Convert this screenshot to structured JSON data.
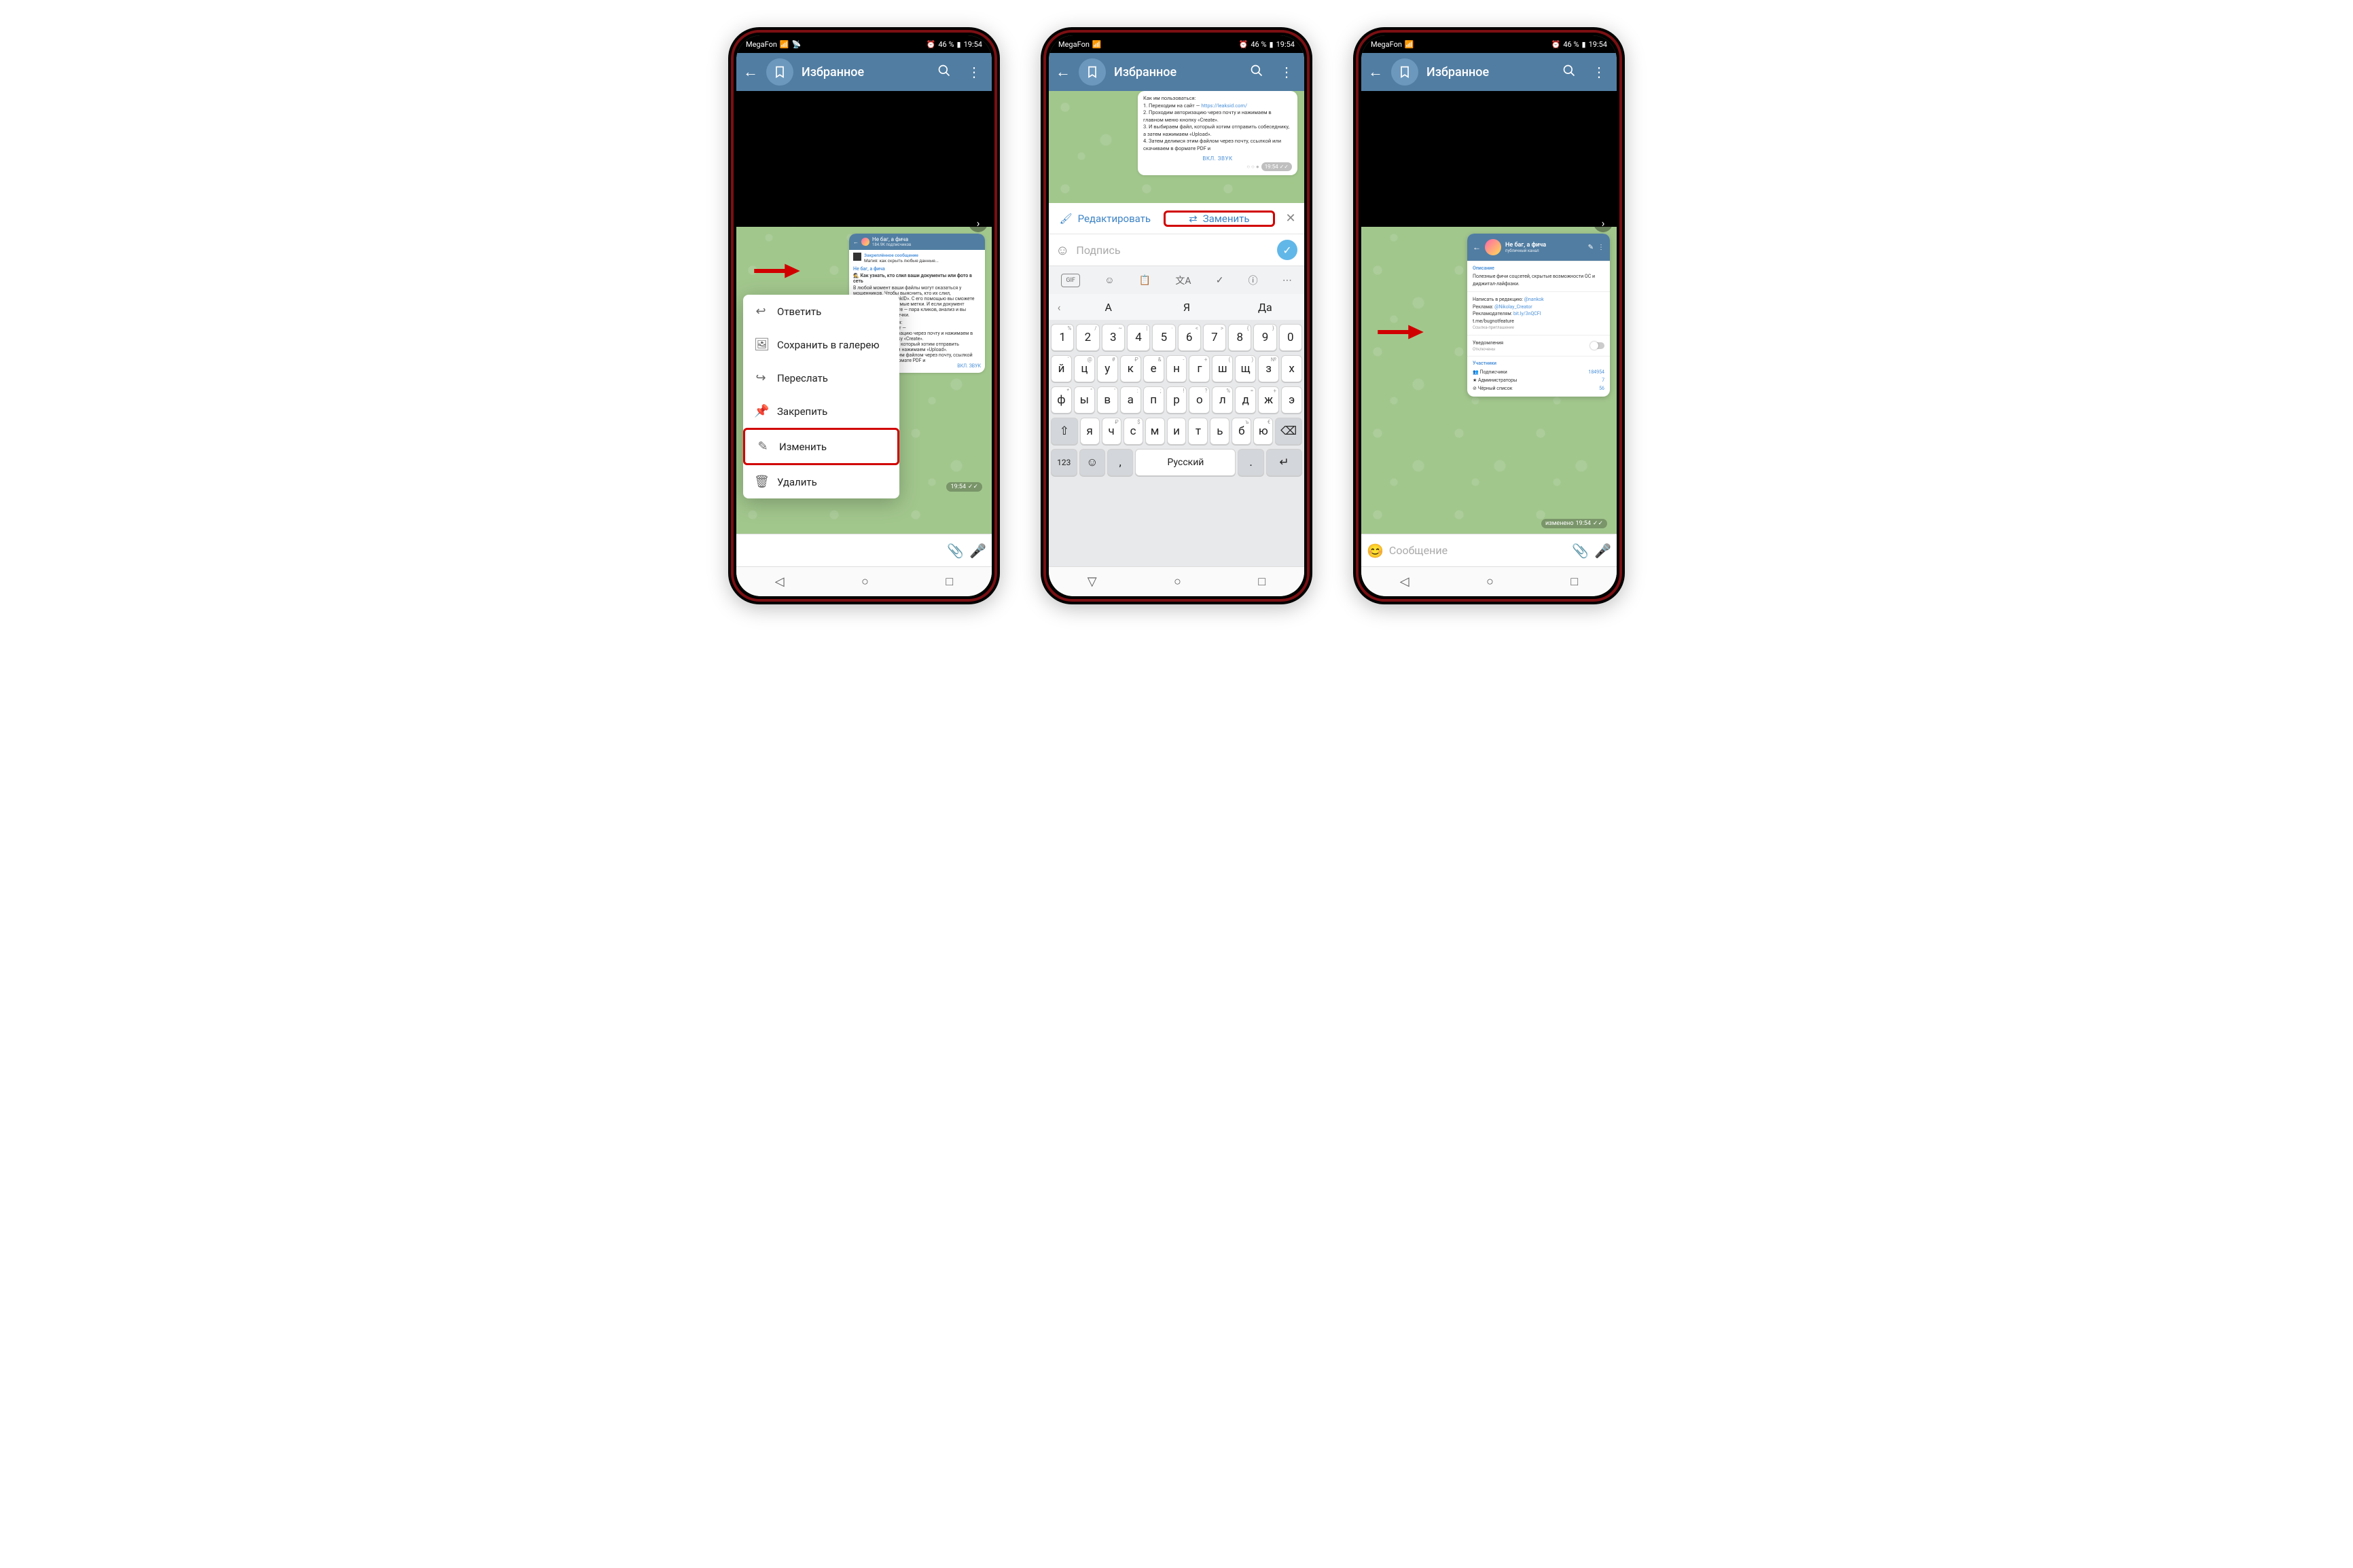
{
  "status": {
    "carrier": "MegaFon",
    "net": "4G",
    "battery": "46 %",
    "time": "19:54",
    "alarm_icon": "⏰"
  },
  "header": {
    "title": "Избранное"
  },
  "ctx": {
    "reply": "Ответить",
    "save": "Сохранить в галерею",
    "forward": "Переслать",
    "pin": "Закрепить",
    "edit": "Изменить",
    "delete": "Удалить"
  },
  "message1": {
    "channel": "Не баг, а фича",
    "subs": "184.9K подписчиков",
    "pinned_label": "Закреплённое сообщение",
    "pinned_text": "Магия: как скрыть любые данные...",
    "reply_ch": "Не баг, а фича",
    "title": "🕵 Как узнать, кто слил ваши документы или фото в сеть",
    "body": "В любой момент ваши файлы могут оказаться у мошенников. Чтобы выяснить, кто их слил, воспользуйтесь «LeakID». С его помощью вы сможете прикреплять невидимые метки. И если документ всплывёт в интернете — пара кликов, анализ и вы узнаете источник утечки.",
    "howto": "Как им пользоваться:",
    "s1": "1. Переходим на сайт —",
    "s2": "2. Проходим авторизацию через почту и нажимаем в главном меню кнопку «Create».",
    "s3": "3. И выбираем файл, который хотим отправить собеседнику, а затем нажимаем «Upload».",
    "s4": "4. Затем делимся этим файлом через почту, ссылкой или скачиваем в формате PDF и",
    "sound": "ВКЛ. ЗВУК",
    "msg_time": "19:54"
  },
  "phone2": {
    "edit": "Редактировать",
    "replace": "Заменить",
    "caption_placeholder": "Подпись",
    "suggestions": [
      "А",
      "Я",
      "Да"
    ],
    "row_num": [
      "1",
      "2",
      "3",
      "4",
      "5",
      "6",
      "7",
      "8",
      "9",
      "0"
    ],
    "row_num_hints": [
      "%",
      "/",
      "~",
      "|",
      "·",
      "<",
      ">",
      "{",
      "}",
      ""
    ],
    "row1": [
      "й",
      "ц",
      "у",
      "к",
      "е",
      "н",
      "г",
      "ш",
      "щ",
      "з",
      "х"
    ],
    "row1_hints": [
      "`",
      "@",
      "#",
      "₽",
      "&",
      "-",
      "+",
      "(",
      ")",
      "№",
      ""
    ],
    "row2": [
      "ф",
      "ы",
      "в",
      "а",
      "п",
      "р",
      "о",
      "л",
      "д",
      "ж",
      "э"
    ],
    "row2_hints": [
      "*",
      "\"",
      "'",
      ":",
      ";",
      "!",
      "?",
      "%",
      "=",
      "+",
      ""
    ],
    "row3": [
      "я",
      "ч",
      "с",
      "м",
      "и",
      "т",
      "ь",
      "б",
      "ю"
    ],
    "row3_hints": [
      "",
      "₽",
      "$",
      "",
      "",
      "",
      "",
      "ъ",
      "€"
    ],
    "space": "Русский",
    "num_key": "123",
    "link": "https://leaksid.com/"
  },
  "phone3": {
    "input_placeholder": "Сообщение",
    "profile": {
      "name": "Не баг, а фича",
      "sub": "публичный канал",
      "desc_label": "Описание",
      "desc": "Полезные фичи соцсетей, скрытые возможности ОС и диджитал-лайфхаки.",
      "writeto": "Написать в редакцию:",
      "writeto_link": "@nankok",
      "ads": "Реклама:",
      "ads_link": "@Nikolay_Creator",
      "advertisers": "Рекламодателям:",
      "advertisers_link": "bit.ly/3nQCFI",
      "tme": "t.me/bugnotfeature",
      "invite": "Ссылка-приглашение",
      "notif": "Уведомления",
      "notif_state": "Отключены",
      "members_label": "Участники",
      "subs_label": "Подписчики",
      "subs_n": "184954",
      "admins_label": "Администраторы",
      "admins_n": "7",
      "bl_label": "Чёрный список",
      "bl_n": "56"
    },
    "edited": "изменено",
    "msg_time": "19:54"
  }
}
